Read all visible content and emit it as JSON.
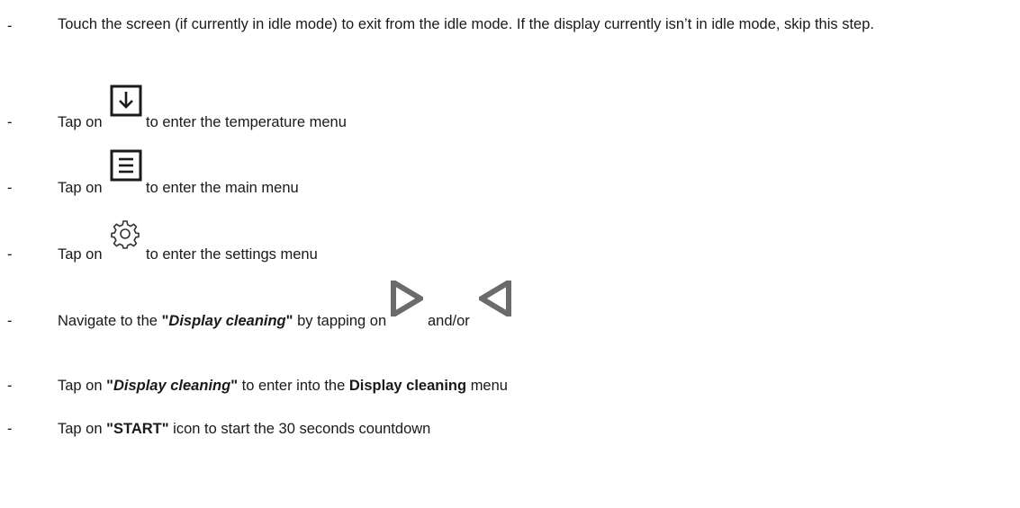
{
  "steps": [
    {
      "dash": "-",
      "text": "Touch the screen (if currently in idle mode) to exit from the idle mode. If the display currently isn’t in idle mode, skip this step."
    },
    {
      "dash": "-",
      "before": "Tap on",
      "after": "to enter the temperature menu",
      "icon": "down-arrow-icon"
    },
    {
      "dash": "-",
      "before": "Tap on",
      "after": "to enter the main menu",
      "icon": "hamburger-menu-icon"
    },
    {
      "dash": "-",
      "before": "Tap on",
      "after": "to enter the settings menu",
      "icon": "gear-icon"
    },
    {
      "dash": "-",
      "before": "Navigate to the",
      "quote_open": "\"",
      "emph": "Display cleaning",
      "quote_close": "\"",
      "middle": "by tapping on",
      "and_or": "and/or",
      "icons": [
        "right-triangle-icon",
        "left-triangle-icon"
      ]
    },
    {
      "dash": "-",
      "before": "Tap on",
      "quote_open": "\"",
      "emph": "Display cleaning",
      "quote_close": "\"",
      "middle": "to enter into the",
      "bold": "Display cleaning",
      "after": "menu"
    },
    {
      "dash": "-",
      "before": "Tap on",
      "bold": "\"START\"",
      "after": "icon to start the 30 seconds countdown"
    }
  ]
}
